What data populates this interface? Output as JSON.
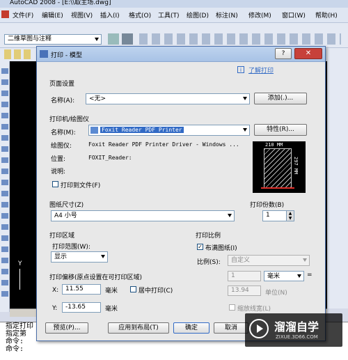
{
  "app": {
    "title": "AutoCAD 2008 - [E:\\\\取主场.dwg]",
    "menu": [
      "文件(F)",
      "编辑(E)",
      "视图(V)",
      "插入(I)",
      "格式(O)",
      "工具(T)",
      "绘图(D)",
      "标注(N)",
      "修改(M)",
      "窗口(W)",
      "帮助(H)"
    ],
    "workspace": "二维草图与注释",
    "command_lines": [
      "指定打印",
      "指定第",
      "命令:",
      "命令:"
    ]
  },
  "dialog": {
    "title": "打印 - 模型",
    "help_link": "了解打印",
    "page_setup": {
      "section": "页面设置",
      "name_label": "名称(A):",
      "name_value": "<无>",
      "add_button": "添加(.)..."
    },
    "printer": {
      "section": "打印机/绘图仪",
      "name_label": "名称(M):",
      "name_value": "Foxit Reader PDF Printer",
      "properties_button": "特性(R)...",
      "plotter_label": "绘图仪:",
      "plotter_value": "Foxit Reader PDF Printer Driver - Windows ...",
      "location_label": "位置:",
      "location_value": "FOXIT_Reader:",
      "description_label": "说明:",
      "print_to_file": "打印到文件(F)",
      "preview_width": "210 MM",
      "preview_height": "297 MM"
    },
    "paper_size": {
      "section": "图纸尺寸(Z)",
      "value": "A4 小号"
    },
    "copies": {
      "section": "打印份数(B)",
      "value": "1"
    },
    "plot_area": {
      "section": "打印区域",
      "range_label": "打印范围(W):",
      "range_value": "显示"
    },
    "plot_scale": {
      "section": "打印比例",
      "fit_paper": "布满图纸(I)",
      "scale_label": "比例(S):",
      "scale_value": "自定义",
      "ratio_top": "1",
      "unit_value": "毫米",
      "ratio_bottom": "13.94",
      "unit_label": "单位(N)",
      "scale_lineweights": "缩放线宽(L)"
    },
    "plot_offset": {
      "section": "打印偏移(原点设置在可打印区域)",
      "x_label": "X:",
      "x_value": "11.55",
      "x_unit": "毫米",
      "center_plot": "居中打印(C)",
      "y_label": "Y:",
      "y_value": "-13.65",
      "y_unit": "毫米"
    },
    "buttons": {
      "preview": "预览(P)...",
      "apply_layout": "应用到布局(T)",
      "ok": "确定",
      "cancel": "取消"
    }
  },
  "watermark": {
    "name": "溜溜自学",
    "url": "ZIXUE.3D66.COM"
  },
  "colors": {
    "accent": "#316ac5",
    "dialog_bg": "#e8e8e8",
    "drawing_bg": "#000000",
    "close_red": "#c7413a"
  }
}
